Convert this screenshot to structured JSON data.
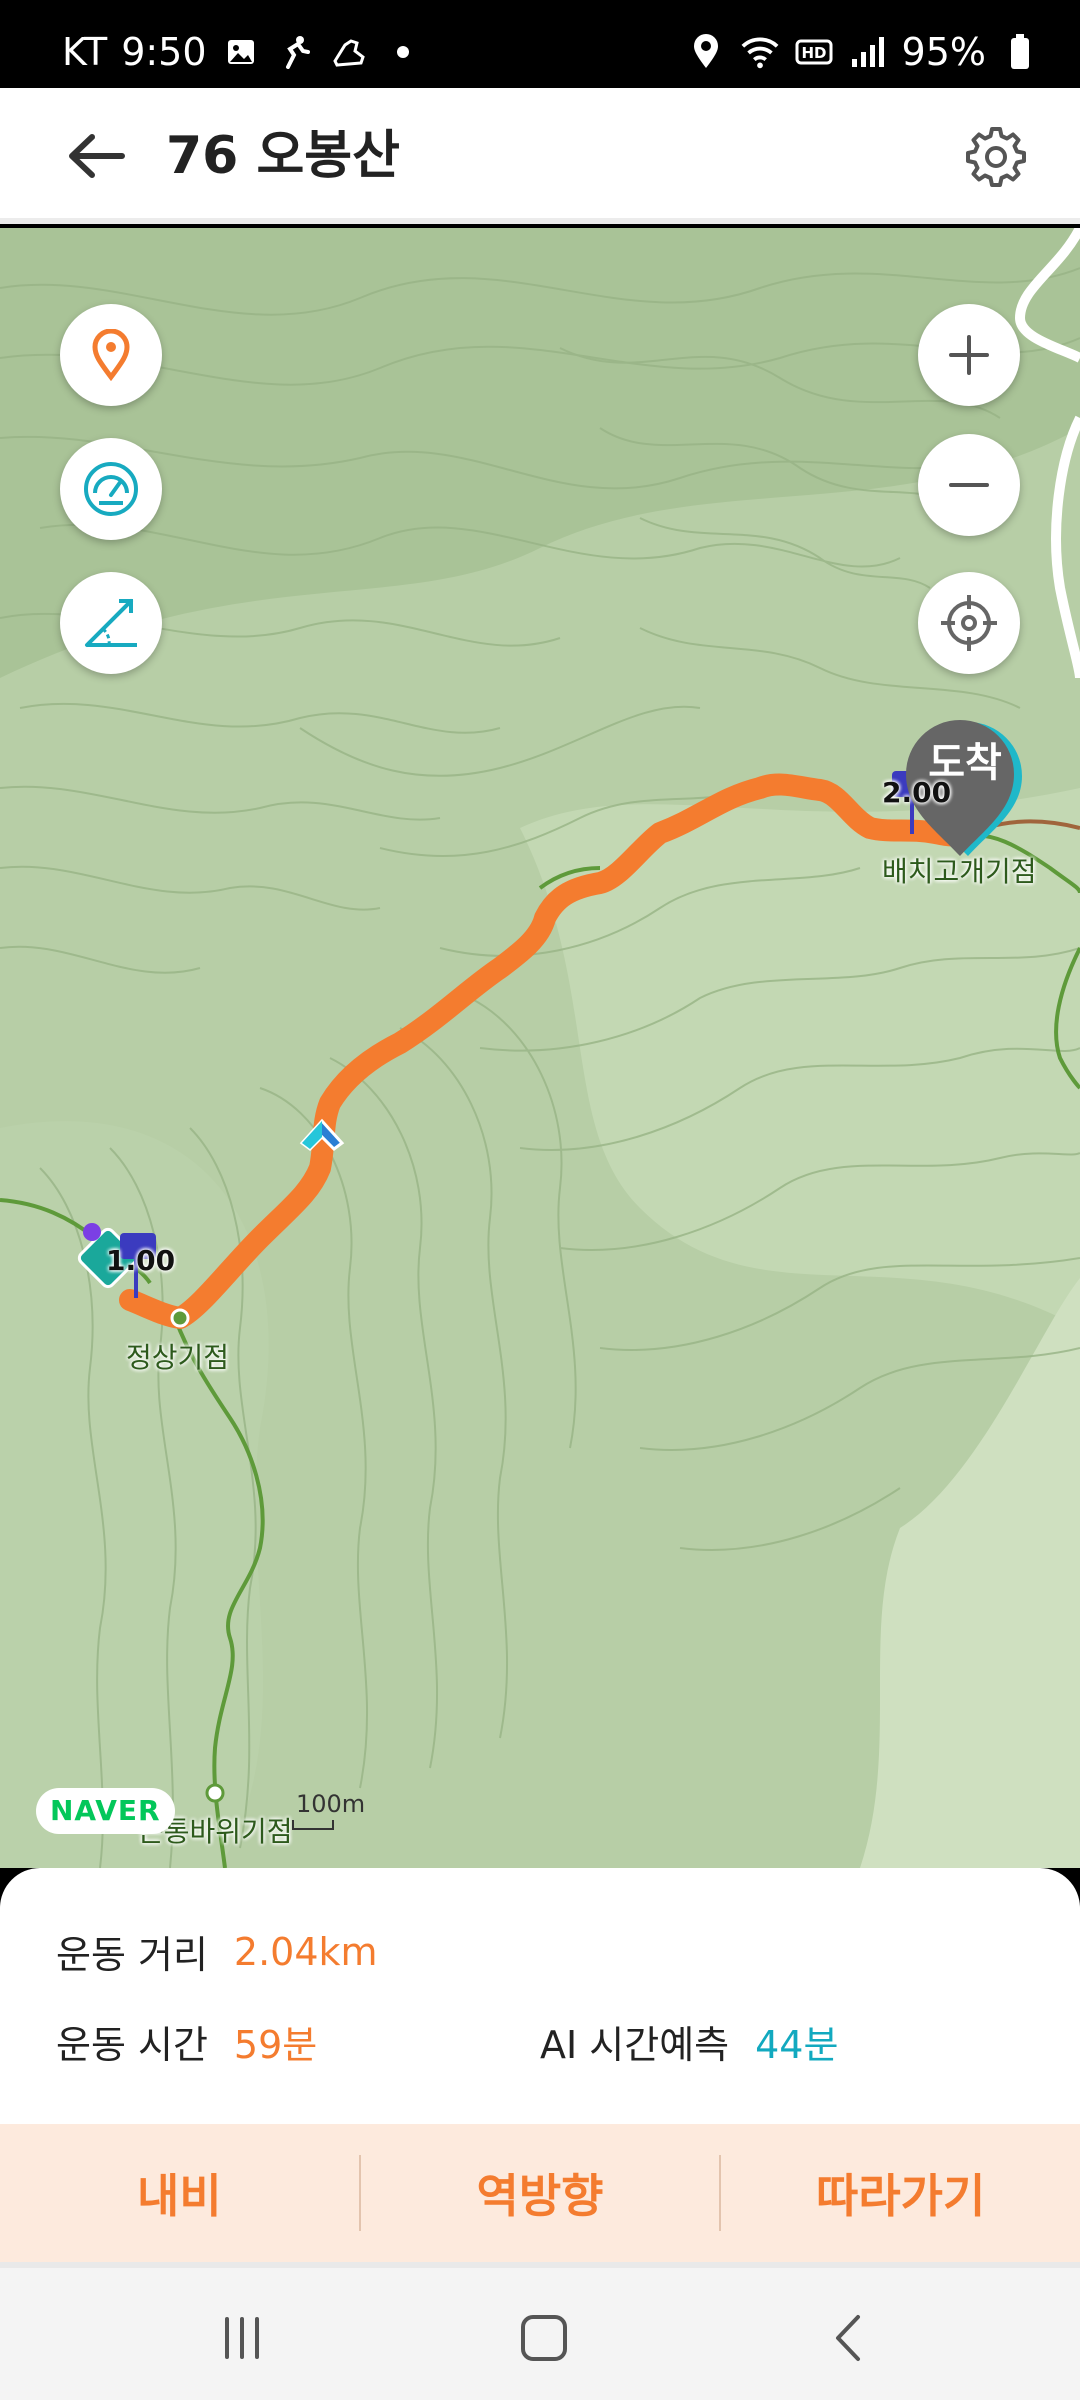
{
  "status_bar": {
    "carrier": "KT",
    "time": "9:50",
    "battery": "95%",
    "icons": [
      "gallery-icon",
      "running-icon",
      "shoe-icon",
      "dot-icon",
      "location-icon",
      "wifi-icon",
      "hd-icon",
      "signal-icon",
      "battery-icon"
    ]
  },
  "header": {
    "title": "76 오봉산",
    "back_icon": "back-arrow-icon",
    "settings_icon": "gear-icon"
  },
  "map": {
    "left_controls": [
      "location-pin-icon",
      "speedometer-icon",
      "slope-icon"
    ],
    "right_controls": [
      "zoom-in-icon",
      "zoom-out-icon",
      "locate-crosshair-icon"
    ],
    "waypoints": {
      "start": "정상기점",
      "end": "배치고개기점",
      "bottom": "큰통바위기점"
    },
    "km_markers": [
      "1.00",
      "2.00"
    ],
    "arrive_label": "도착",
    "naver_logo": "NAVER",
    "scale": "100m",
    "route_color": "#f47c2f"
  },
  "info": {
    "distance_label": "운동 거리",
    "distance_value": "2.04km",
    "time_label": "운동 시간",
    "time_value": "59분",
    "ai_label": "AI 시간예측",
    "ai_value": "44분"
  },
  "actions": {
    "nav": "내비",
    "reverse": "역방향",
    "follow": "따라가기"
  },
  "nav_bar": [
    "recent-apps-icon",
    "home-icon",
    "back-icon"
  ]
}
